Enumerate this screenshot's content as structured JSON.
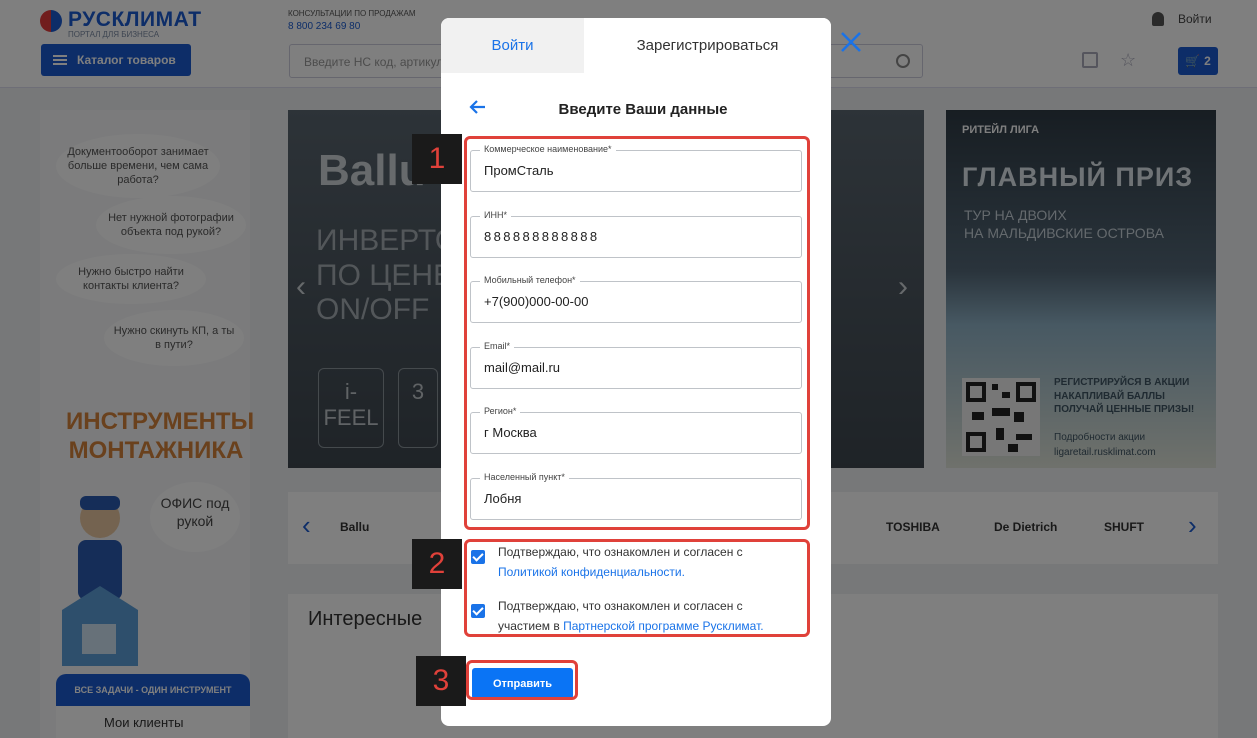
{
  "header": {
    "logo_text": "РУСКЛИМАТ",
    "logo_sub": "ПОРТАЛ ДЛЯ БИЗНЕСА",
    "consult_label": "КОНСУЛЬТАЦИИ ПО ПРОДАЖАМ",
    "consult_phone": "8 800 234 69 80",
    "catalog_label": "Каталог товаров",
    "search_placeholder": "Введите НС код, артикул",
    "login_label": "Войти",
    "cart_count": "2"
  },
  "left_panel": {
    "bubbles": [
      "Документооборот занимает больше времени, чем сама работа?",
      "Нет нужной фотографии объекта под рукой?",
      "Нужно быстро найти контакты клиента?",
      "Нужно скинуть КП, а ты в пути?"
    ],
    "promo_title": "ИНСТРУМЕНТЫ МОНТАЖНИКА",
    "office_text": "ОФИС под рукой",
    "tasks_tab": "ВСЕ ЗАДАЧИ - ОДИН ИНСТРУМЕНТ",
    "clients_label": "Мои клиенты"
  },
  "banner_main": {
    "brand": "Ballu",
    "headline": [
      "ИНВЕРТОР",
      "ПО ЦЕНЕ",
      "ON/OFF"
    ],
    "feature_1": "i-FEEL",
    "feature_2": "3"
  },
  "banner_side": {
    "logo": "РИТЕЙЛ ЛИГА",
    "title": "ГЛАВНЫЙ ПРИЗ",
    "subtitle": [
      "ТУР НА ДВОИХ",
      "НА МАЛЬДИВСКИЕ ОСТРОВА"
    ],
    "register_text": [
      "РЕГИСТРИРУЙСЯ В АКЦИИ",
      "НАКАПЛИВАЙ БАЛЛЫ",
      "ПОЛУЧАЙ ЦЕННЫЕ ПРИЗЫ!"
    ],
    "details_link": "Подробности акции",
    "site": "ligaretail.rusklimat.com"
  },
  "brands": [
    "Ballu",
    "TOSHIBA",
    "De Dietrich",
    "SHUFT"
  ],
  "interesting_title": "Интересные",
  "modal": {
    "tab_login": "Войти",
    "tab_register": "Зарегистрироваться",
    "title": "Введите Ваши данные",
    "fields": [
      {
        "label": "Коммерческое наименование*",
        "value": "ПромСталь"
      },
      {
        "label": "ИНН*",
        "value": "888888888888"
      },
      {
        "label": "Мобильный телефон*",
        "value": "+7(900)000-00-00"
      },
      {
        "label": "Email*",
        "value": "mail@mail.ru"
      },
      {
        "label": "Регион*",
        "value": "г Москва"
      },
      {
        "label": "Населенный пункт*",
        "value": "Лобня"
      }
    ],
    "consent_1_text": "Подтверждаю, что ознакомлен и согласен с",
    "consent_1_link": "Политикой конфиденциальности.",
    "consent_2_text": "Подтверждаю, что ознакомлен и согласен с участием в",
    "consent_2_link": "Партнерской программе Русклимат.",
    "submit_label": "Отправить"
  },
  "annotations": [
    "1",
    "2",
    "3"
  ],
  "colors": {
    "accent": "#1a73e8",
    "button": "#0a74f5",
    "highlight": "#e0413a"
  }
}
